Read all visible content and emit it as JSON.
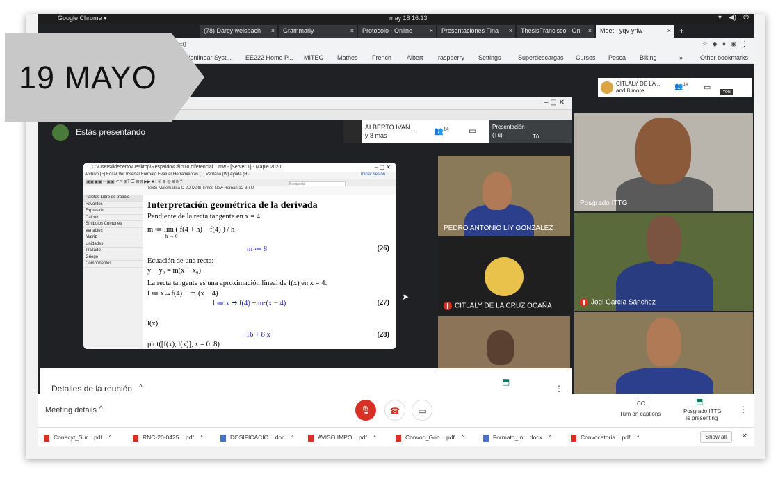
{
  "banner": {
    "text": "19 MAYO"
  },
  "system_bar": {
    "app": "Google Chrome ▾",
    "datetime": "may 18  16:13"
  },
  "browser_tabs": [
    {
      "label": "(78) Darcy weisbach",
      "active": false
    },
    {
      "label": "Grammarly",
      "active": false
    },
    {
      "label": "Protocolo - Online",
      "active": false
    },
    {
      "label": "Presentaciones Fina",
      "active": false
    },
    {
      "label": "ThesisFrancisco - On",
      "active": false
    },
    {
      "label": "Meet - yqv-yriw-",
      "active": true
    }
  ],
  "address_bar": {
    "url": "ser=0"
  },
  "bookmarks": [
    "Nonlinear Syst...",
    "EE222 Home P...",
    "MITEC",
    "Mathes",
    "French",
    "Albert",
    "raspberry",
    "Settings",
    "Superdescargas",
    "Cursos",
    "Pesca",
    "Biking",
    "»",
    "Other bookmarks"
  ],
  "meet": {
    "presenting_text": "Estás presentando",
    "top_participant": {
      "name": "ALBERTO IVAN ...",
      "more": "y 8 más"
    },
    "people_count": "14",
    "presentation_label": "Presentación",
    "presentation_sub": "(Tú)",
    "you_label": "Tú",
    "right_top_participant": {
      "name": "CITLALY DE LA ...",
      "more": "and 8 more"
    },
    "right_people_count": "14",
    "you_short": "You",
    "tiles": {
      "pedro": "PEDRO ANTONIO LIY GONZALEZ",
      "citlaly": "CITLALY DE LA CRUZ OCAÑA",
      "posgrado": "Posgrado ITTG",
      "joel": "Joel García Sánchez"
    },
    "details_inner": "Detalles de la reunión",
    "details_outer": "Meeting details",
    "captions": "Turn on captions",
    "presenting_status_1": "Posgrado ITTG",
    "presenting_status_2": "is presenting"
  },
  "maple": {
    "title": "C:\\Users\\lldeberto\\Desktop\\Respaldo\\Cálculo diferencial 1.mw - [Server 1] - Maple 2020",
    "menu": "Archivo (F) Editar Ver Insertar Formato Evaluar Herramientas (T) Ventana (W) Ayuda (H)",
    "signin": "Iniciar sesión",
    "toolbar2": "Texto  Matemática   C  2D Math      Times New Roman    12    B I U",
    "search": "Búsqueda",
    "palettes_header": "Paletas  Libro de trabajo",
    "palettes": [
      "Favoritos",
      "Expresión",
      "Cálculo",
      "Símbolos Comunes",
      "Variables",
      "Matriz",
      "Unidades",
      "Trazado",
      "Griego",
      "Componentes"
    ],
    "heading": "Interpretación geométrica de la derivada",
    "line1": "Pendiente de la recta tangente en x = 4:",
    "line2": "m ≔ lim  ( f(4 + h) − f(4) ) / h",
    "line2b": "h → 0",
    "out26": "m ≔ 8",
    "n26": "(26)",
    "line3": "Ecuación de una recta:",
    "line4": "y − y₀ = m(x − x₀)",
    "line5": "La recta tangente es una aproximación lineal de f(x) en x = 4:",
    "line6": "l ≔ x→f(4) + m·(x − 4)",
    "out27": "l ≔ x ↦ f(4) + m·(x − 4)",
    "n27": "(27)",
    "line7": "l(x)",
    "out28": "−16 + 8 x",
    "n28": "(28)",
    "line8": "plot([f(x), l(x)], x = 0..8)"
  },
  "downloads": [
    {
      "name": "Conacyt_Sur....pdf",
      "type": "pdf"
    },
    {
      "name": "RNC-20-0425....pdf",
      "type": "pdf"
    },
    {
      "name": "DOSIFICACIO....doc",
      "type": "doc"
    },
    {
      "name": "AVISO IMPO....pdf",
      "type": "pdf"
    },
    {
      "name": "Convoc_Gob....pdf",
      "type": "pdf"
    },
    {
      "name": "Formato_In....docx",
      "type": "doc"
    },
    {
      "name": "Convocatoria....pdf",
      "type": "pdf"
    }
  ],
  "show_all": "Show all"
}
